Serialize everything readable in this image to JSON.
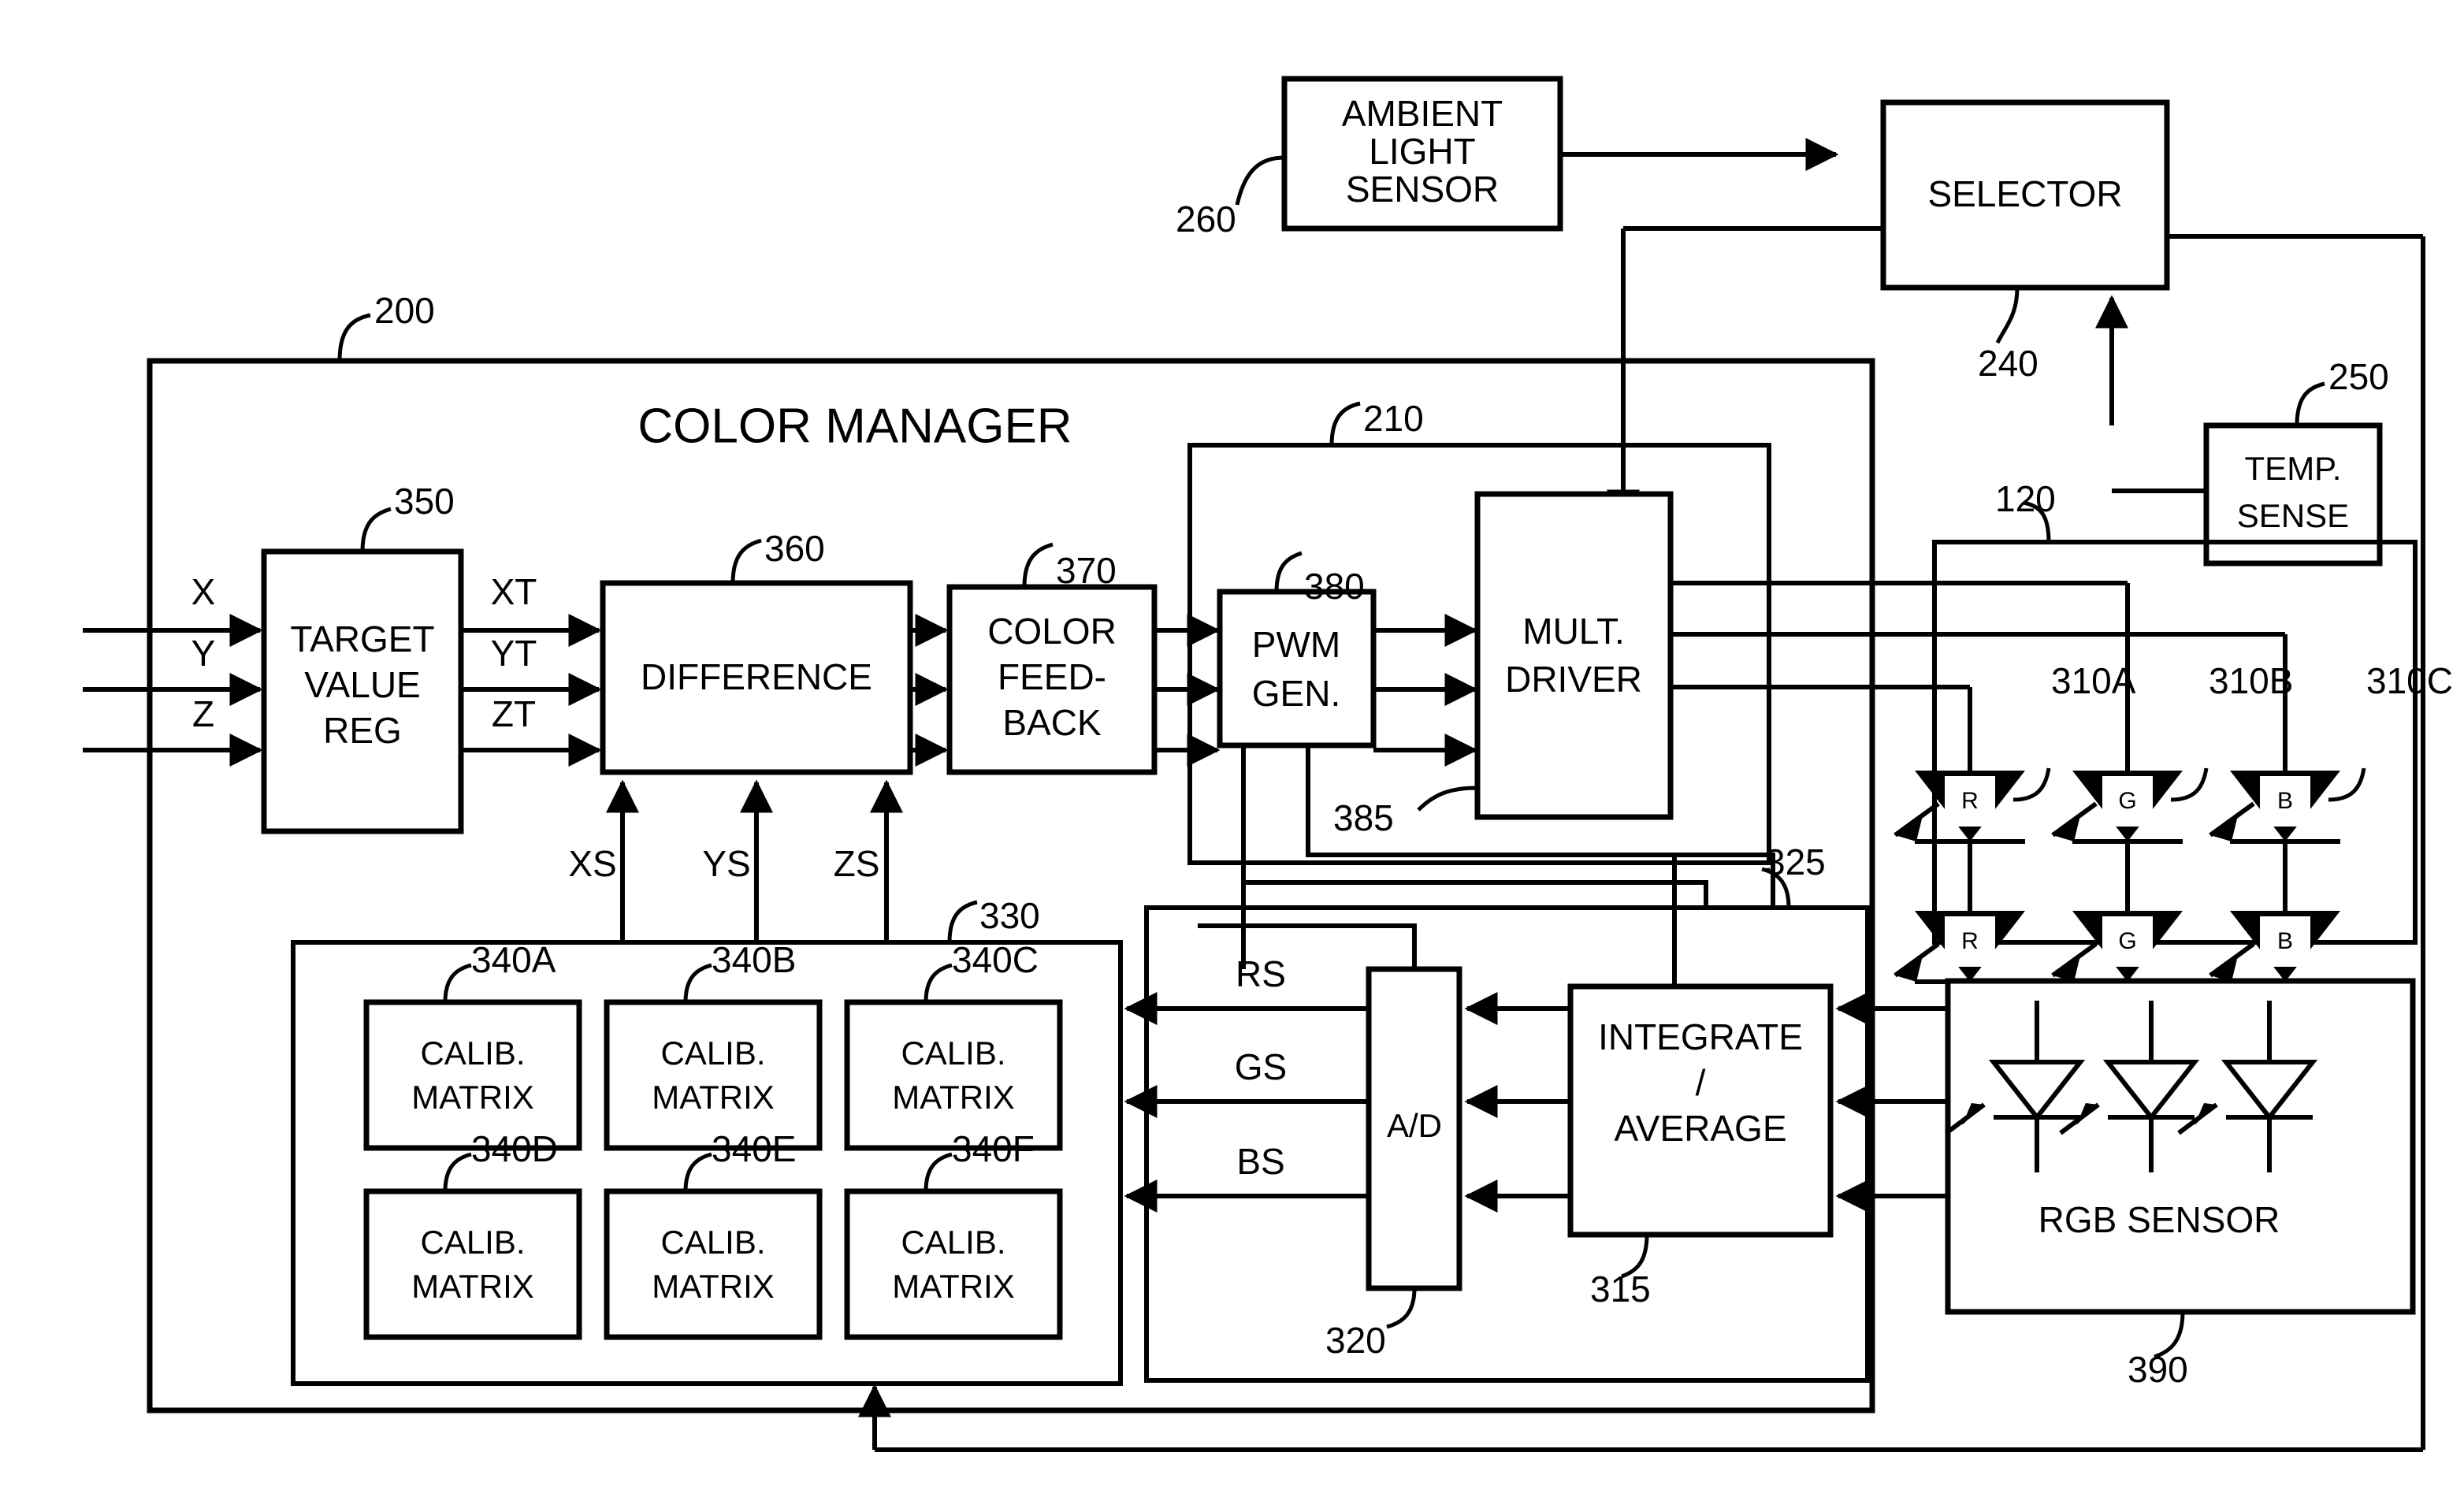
{
  "figure": {
    "title": "COLOR MANAGER",
    "type": "patent-block-diagram"
  },
  "blocks": {
    "ambient_light_sensor": {
      "label_lines": [
        "AMBIENT",
        "LIGHT",
        "SENSOR"
      ],
      "ref": "260"
    },
    "selector": {
      "label_lines": [
        "SELECTOR"
      ],
      "ref": "240"
    },
    "temp_sense": {
      "label_lines": [
        "TEMP.",
        "SENSE"
      ],
      "ref": "250"
    },
    "color_manager": {
      "label_lines": [
        "COLOR MANAGER"
      ],
      "ref": "200"
    },
    "target_value_reg": {
      "label_lines": [
        "TARGET",
        "VALUE",
        "REG"
      ],
      "ref": "350"
    },
    "difference": {
      "label_lines": [
        "DIFFERENCE"
      ],
      "ref": "360"
    },
    "color_feedback": {
      "label_lines": [
        "COLOR",
        "FEED-",
        "BACK"
      ],
      "ref": "370"
    },
    "pwm_gen": {
      "label_lines": [
        "PWM",
        "GEN."
      ],
      "ref": "380"
    },
    "mult_driver": {
      "label_lines": [
        "MULT.",
        "DRIVER"
      ],
      "ref": "385"
    },
    "driver_group": {
      "label_lines": [],
      "ref": "210"
    },
    "led_array": {
      "label_lines": [],
      "ref": "120"
    },
    "calib_group": {
      "label_lines": [],
      "ref": "330"
    },
    "sense_group": {
      "label_lines": [],
      "ref": "325"
    },
    "ad_converter": {
      "label_lines": [
        "A/D"
      ],
      "ref": "320"
    },
    "integrate_average": {
      "label_lines": [
        "INTEGRATE",
        "/",
        "AVERAGE"
      ],
      "ref": "315"
    },
    "rgb_sensor": {
      "label_lines": [
        "RGB SENSOR"
      ],
      "ref": "390"
    }
  },
  "calib_matrices": [
    {
      "label_lines": [
        "CALIB.",
        "MATRIX"
      ],
      "ref": "340A"
    },
    {
      "label_lines": [
        "CALIB.",
        "MATRIX"
      ],
      "ref": "340B"
    },
    {
      "label_lines": [
        "CALIB.",
        "MATRIX"
      ],
      "ref": "340C"
    },
    {
      "label_lines": [
        "CALIB.",
        "MATRIX"
      ],
      "ref": "340D"
    },
    {
      "label_lines": [
        "CALIB.",
        "MATRIX"
      ],
      "ref": "340E"
    },
    {
      "label_lines": [
        "CALIB.",
        "MATRIX"
      ],
      "ref": "340F"
    }
  ],
  "led_strings": [
    {
      "ref": "310A",
      "letter": "R"
    },
    {
      "ref": "310B",
      "letter": "G"
    },
    {
      "ref": "310C",
      "letter": "B"
    }
  ],
  "signals": {
    "inputs": [
      "X",
      "Y",
      "Z"
    ],
    "targets": [
      "XT",
      "YT",
      "ZT"
    ],
    "sensed": [
      "XS",
      "YS",
      "ZS"
    ],
    "rgb_sensed": [
      "RS",
      "GS",
      "BS"
    ]
  }
}
